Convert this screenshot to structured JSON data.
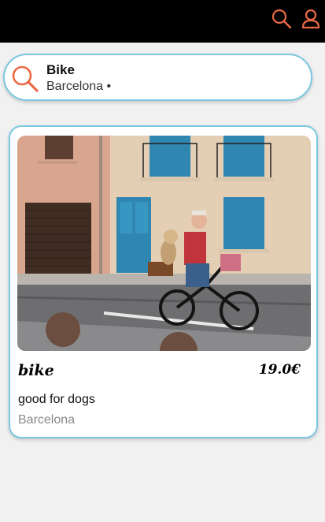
{
  "header": {
    "icons": [
      "search-icon",
      "user-icon"
    ],
    "accent_color": "#ea6a47",
    "background": "#000000"
  },
  "search": {
    "title": "Bike",
    "subtitle": "Barcelona •",
    "border_color": "#7cc7e0"
  },
  "listing": {
    "title": "bike",
    "price": "19.0€",
    "description": "good for dogs",
    "location": "Barcelona",
    "image": "photo-of-man-riding-e-bike-with-dog"
  }
}
